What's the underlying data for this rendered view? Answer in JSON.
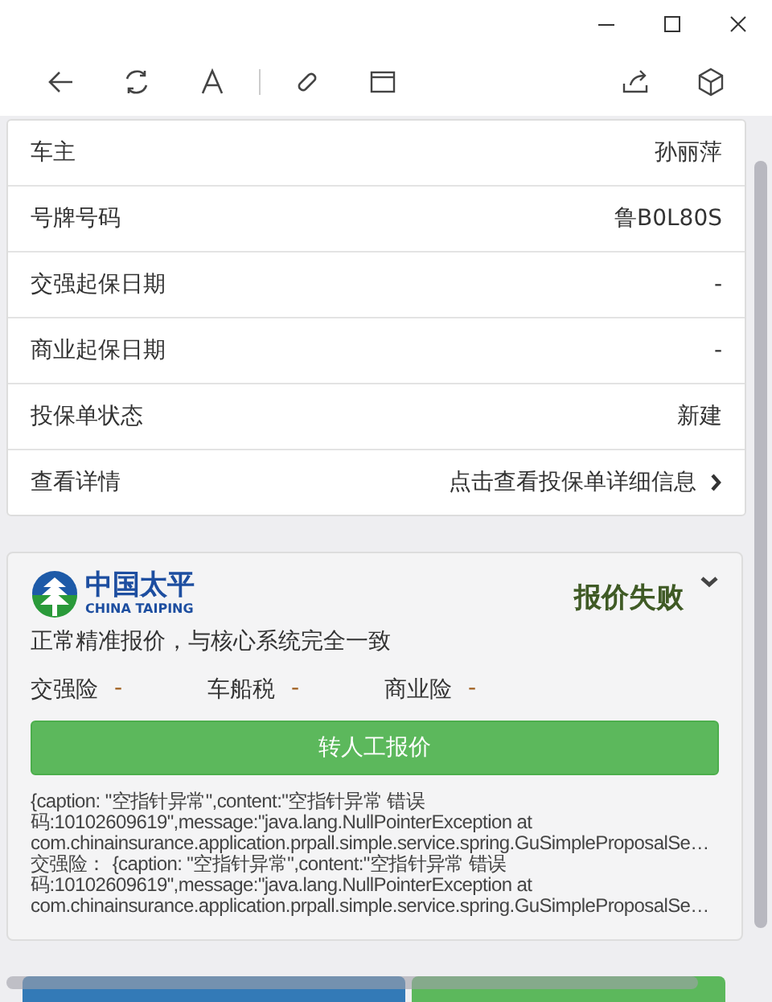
{
  "info_rows": [
    {
      "label": "车主",
      "value": "孙丽萍",
      "kind": "text"
    },
    {
      "label": "号牌号码",
      "value": "鲁B0L80S",
      "kind": "text"
    },
    {
      "label": "交强起保日期",
      "value": "-",
      "kind": "text"
    },
    {
      "label": "商业起保日期",
      "value": "-",
      "kind": "text"
    },
    {
      "label": "投保单状态",
      "value": "新建",
      "kind": "text"
    },
    {
      "label": "查看详情",
      "value": "点击查看投保单详细信息",
      "kind": "link"
    }
  ],
  "quote_card": {
    "logo_cn": "中国太平",
    "logo_en": "CHINA TAIPING",
    "status": "报价失败",
    "expanded": false,
    "description": "正常精准报价，与核心系统完全一致",
    "premiums": [
      {
        "label": "交强险",
        "value": "-"
      },
      {
        "label": "车船税",
        "value": "-"
      },
      {
        "label": "商业险",
        "value": "-"
      }
    ],
    "manual_button": "转人工报价",
    "errors": [
      {
        "lines": [
          "{caption: \"空指针异常\",content:\"空指针异常 错误",
          "码:10102609619\",message:\"java.lang.NullPointerException at",
          "com.chinainsurance.application.prpall.simple.service.spring.GuSimpleProposalSe…"
        ]
      },
      {
        "prefix": "交强险：",
        "lines": [
          "{caption: \"空指针异常\",content:\"空指针异常 错误",
          "码:10102609619\",message:\"java.lang.NullPointerException at",
          "com.chinainsurance.application.prpall.simple.service.spring.GuSimpleProposalSe…"
        ]
      }
    ]
  }
}
